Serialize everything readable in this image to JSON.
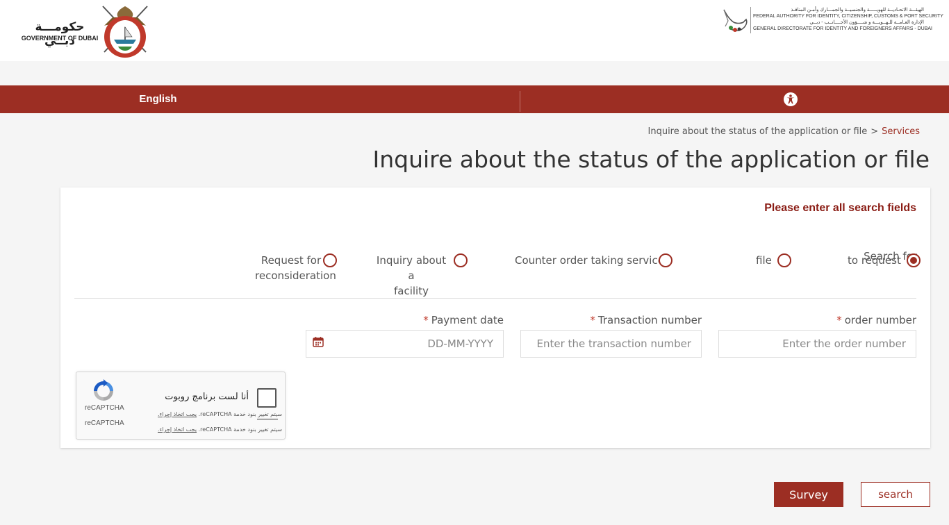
{
  "header": {
    "gov_logo": {
      "arabic_name": "حكومـــة دبــي",
      "english_name": "GOVERNMENT OF DUBAI",
      "emblem_icon": "dubai-emblem-icon"
    },
    "ica_logo": {
      "lines": [
        "الهيئـــة الاتحـاديــة للهويـــــة والجنسيــة والجمـــارك وأمـن المنافـذ",
        "FEDERAL AUTHORITY FOR IDENTITY, CITIZENSHIP, CUSTOMS & PORT SECURITY",
        "الإدارة العـامــة للـهــويـــة و شــــؤون الأجــــانــب - دبــي",
        "GENERAL DIRECTORATE FOR IDENTITY AND FOREIGNERS AFFAIRS - DUBAI"
      ],
      "bird_icon": "falcon-logo-icon"
    }
  },
  "topbar": {
    "language_label": "English",
    "accessibility_icon": "accessibility-icon",
    "color": "#9c2e23"
  },
  "breadcrumb": {
    "current": "Inquire about the status of the application or file",
    "separator": ">",
    "link": "Services"
  },
  "page_title": "Inquire about the status of the application or file",
  "form": {
    "notice": "Please enter all search fields",
    "search_types": [
      {
        "label": "Search for\nto request",
        "checked": true
      },
      {
        "label": "file",
        "checked": false
      },
      {
        "label": "Counter order taking service",
        "checked": false
      },
      {
        "label": "Inquiry about a\nfacility",
        "checked": false
      },
      {
        "label": "Request for\nreconsideration",
        "checked": false
      }
    ],
    "fields": {
      "order_number": {
        "label": "order number",
        "required_mark": "*",
        "placeholder": "Enter the order number"
      },
      "transaction_number": {
        "label": "Transaction number",
        "required_mark": "*",
        "placeholder": "Enter the transaction number"
      },
      "payment_date": {
        "label": "Payment date",
        "required_mark": "*",
        "placeholder": "DD-MM-YYYY",
        "icon": "calendar-icon"
      }
    },
    "recaptcha": {
      "brand_1": "reCAPTCHA",
      "brand_2": "reCAPTCHA",
      "checkbox_text": "أنا لست برنامج روبوت",
      "notice_prefix": "سيتم تغيير بنود خدمة reCAPTCHA.",
      "notice_link": "يجب اتخاذ إجراء."
    }
  },
  "actions": {
    "survey_label": "Survey",
    "search_label": "search"
  }
}
